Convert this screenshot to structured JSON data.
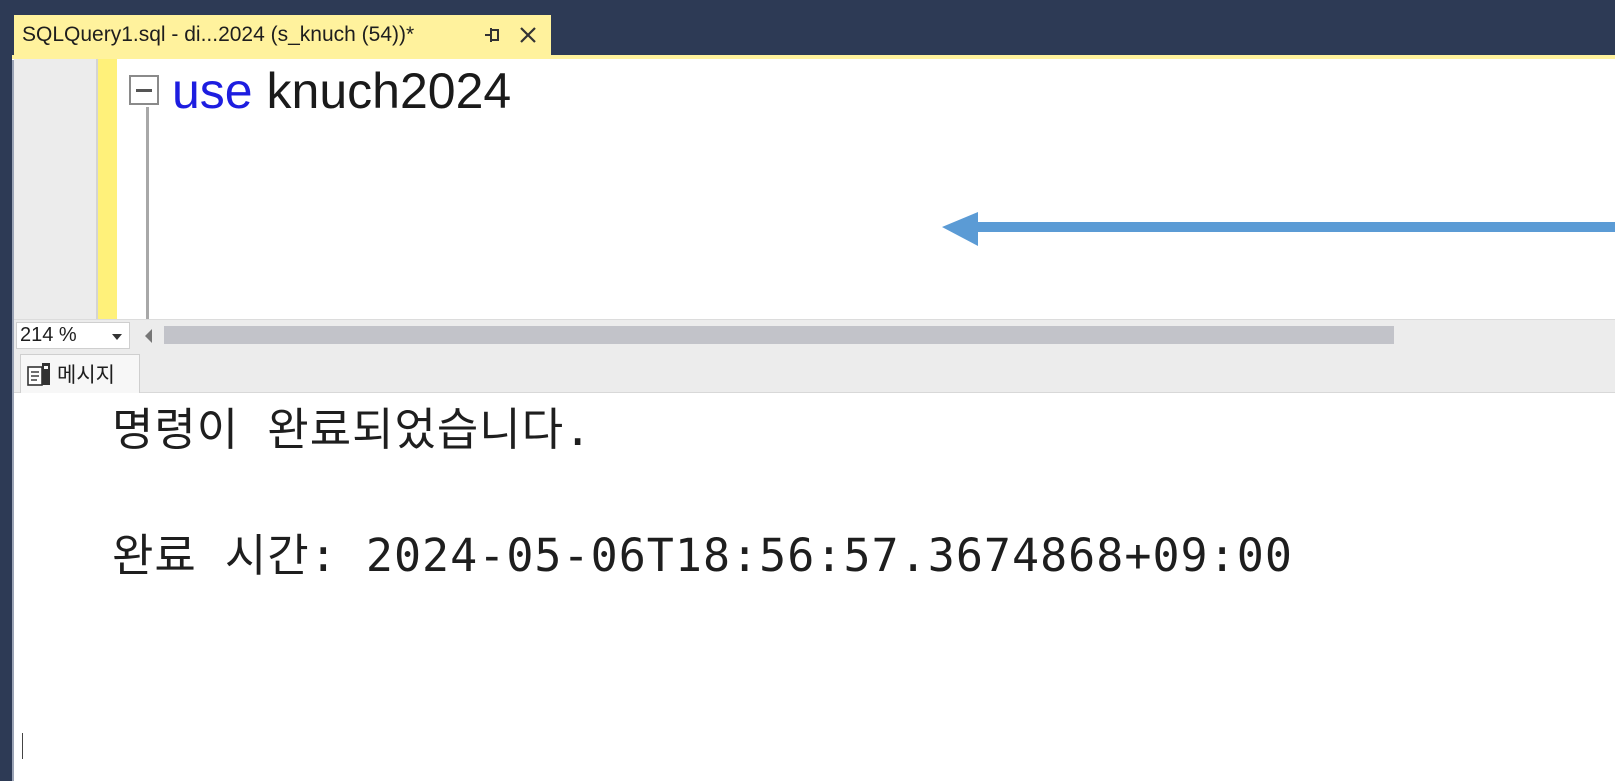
{
  "window": {
    "frame_color": "#2d3a55",
    "tab_color": "#fff29d"
  },
  "document_tab": {
    "title": "SQLQuery1.sql - di...2024 (s_knuch (54))*",
    "pin_icon": "pin-icon",
    "close_icon": "close-icon"
  },
  "editor": {
    "keyword": "use",
    "identifier": "knuch2024",
    "keyword_color": "#1d1de0",
    "fold_icon": "collapse-minus-icon",
    "annotation_arrow_color": "#5b9bd5"
  },
  "zoom": {
    "value": "214 %"
  },
  "results": {
    "tab_label": "메시지",
    "tab_icon": "messages-icon",
    "line1": "명령이 완료되었습니다.",
    "line2": "완료 시간: 2024-05-06T18:56:57.3674868+09:00"
  }
}
